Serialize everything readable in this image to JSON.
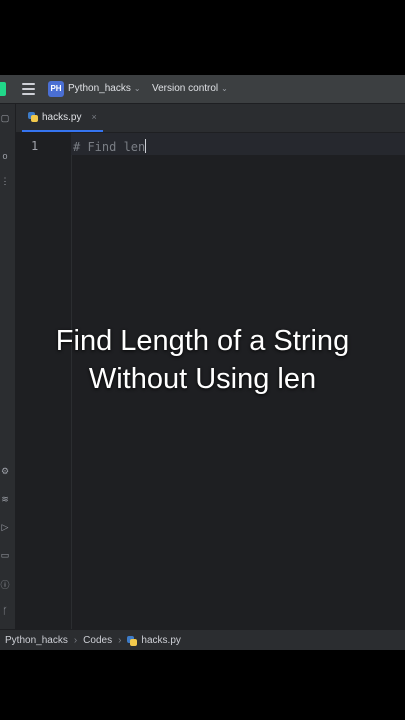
{
  "header": {
    "project_badge": "PH",
    "project_name": "Python_hacks",
    "version_control": "Version control"
  },
  "tabs": [
    {
      "label": "hacks.py",
      "close": "×"
    }
  ],
  "editor": {
    "line_number": "1",
    "code": "# Find len"
  },
  "overlay": {
    "line1": "Find Length of a String",
    "line2": "Without Using len"
  },
  "breadcrumb": {
    "project": "Python_hacks",
    "folder": "Codes",
    "file": "hacks.py"
  },
  "colors": {
    "accent": "#3574f0",
    "logo": "#21d789",
    "badge": "#4a6fd4"
  }
}
